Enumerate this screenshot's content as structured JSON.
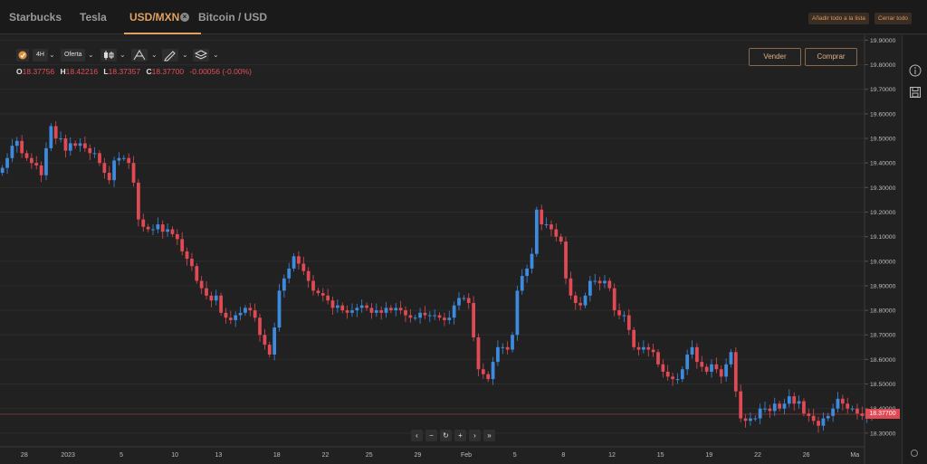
{
  "tabs": [
    {
      "label": "Starbucks"
    },
    {
      "label": "Tesla"
    },
    {
      "label": "USD/MXN",
      "active": true
    },
    {
      "label": "Bitcoin / USD"
    }
  ],
  "top_actions": {
    "add_all": "Añadir todo a la lista",
    "close_all": "Cerrar todo"
  },
  "toolbar": {
    "timeframe": "4H",
    "price_type": "Oferta",
    "icons": [
      "candles-icon",
      "indicators-icon",
      "draw-icon",
      "layers-icon"
    ]
  },
  "ohlc": {
    "o_label": "O",
    "o_value": "18.37756",
    "h_label": "H",
    "h_value": "18.42216",
    "l_label": "L",
    "l_value": "18.37357",
    "c_label": "C",
    "c_value": "18.37700",
    "change": "-0.00056 (-0.00%)"
  },
  "trade": {
    "sell": "Vender",
    "buy": "Comprar"
  },
  "current_price": "18.37700",
  "colors": {
    "up": "#3d8bdf",
    "down": "#e04a55",
    "accent": "#e0a060",
    "background": "#212121"
  },
  "chart_data": {
    "type": "candlestick",
    "ylim": [
      18.27,
      19.92
    ],
    "y_ticks": [
      "19.90000",
      "19.80000",
      "19.70000",
      "19.60000",
      "19.50000",
      "19.40000",
      "19.30000",
      "19.20000",
      "19.10000",
      "19.00000",
      "18.90000",
      "18.80000",
      "18.70000",
      "18.60000",
      "18.50000",
      "18.40000",
      "18.30000"
    ],
    "y_tick_values": [
      19.9,
      19.8,
      19.7,
      19.6,
      19.5,
      19.4,
      19.3,
      19.2,
      19.1,
      19.0,
      18.9,
      18.8,
      18.7,
      18.6,
      18.5,
      18.4,
      18.3
    ],
    "x_ticks": [
      "28",
      "2023",
      "5",
      "10",
      "13",
      "18",
      "22",
      "25",
      "29",
      "Feb",
      "5",
      "8",
      "12",
      "15",
      "19",
      "22",
      "26",
      "Ma"
    ],
    "x_tick_index": [
      5,
      14,
      25,
      36,
      45,
      57,
      67,
      76,
      86,
      96,
      106,
      116,
      126,
      136,
      146,
      156,
      166,
      176
    ],
    "x_index_range": [
      0,
      178
    ],
    "close": [
      19.38,
      19.42,
      19.47,
      19.49,
      19.44,
      19.42,
      19.4,
      19.39,
      19.35,
      19.46,
      19.55,
      19.5,
      19.5,
      19.45,
      19.48,
      19.47,
      19.48,
      19.46,
      19.44,
      19.44,
      19.4,
      19.36,
      19.33,
      19.41,
      19.42,
      19.42,
      19.4,
      19.32,
      19.17,
      19.14,
      19.13,
      19.13,
      19.15,
      19.12,
      19.13,
      19.11,
      19.09,
      19.04,
      19.01,
      18.98,
      18.92,
      18.89,
      18.86,
      18.84,
      18.86,
      18.79,
      18.77,
      18.76,
      18.78,
      18.79,
      18.81,
      18.8,
      18.77,
      18.7,
      18.66,
      18.62,
      18.73,
      18.88,
      18.93,
      18.97,
      19.02,
      18.99,
      18.96,
      18.92,
      18.88,
      18.87,
      18.86,
      18.84,
      18.81,
      18.82,
      18.8,
      18.79,
      18.8,
      18.81,
      18.82,
      18.81,
      18.79,
      18.8,
      18.79,
      18.81,
      18.8,
      18.81,
      18.8,
      18.78,
      18.77,
      18.77,
      18.79,
      18.78,
      18.78,
      18.78,
      18.77,
      18.76,
      18.77,
      18.82,
      18.85,
      18.85,
      18.83,
      18.69,
      18.56,
      18.54,
      18.52,
      18.59,
      18.65,
      18.65,
      18.64,
      18.7,
      18.88,
      18.94,
      18.97,
      19.03,
      19.21,
      19.15,
      19.15,
      19.13,
      19.1,
      19.08,
      18.93,
      18.86,
      18.83,
      18.82,
      18.86,
      18.92,
      18.92,
      18.91,
      18.92,
      18.89,
      18.8,
      18.78,
      18.78,
      18.72,
      18.65,
      18.64,
      18.65,
      18.64,
      18.63,
      18.58,
      18.55,
      18.53,
      18.52,
      18.52,
      18.56,
      18.62,
      18.65,
      18.59,
      18.57,
      18.55,
      18.58,
      18.56,
      18.53,
      18.58,
      18.63,
      18.47,
      18.36,
      18.35,
      18.36,
      18.36,
      18.4,
      18.4,
      18.39,
      18.42,
      18.4,
      18.42,
      18.45,
      18.42,
      18.43,
      18.38,
      18.37,
      18.35,
      18.33,
      18.36,
      18.37,
      18.4,
      18.44,
      18.42,
      18.4,
      18.4,
      18.38,
      18.37,
      18.38,
      18.37
    ]
  }
}
